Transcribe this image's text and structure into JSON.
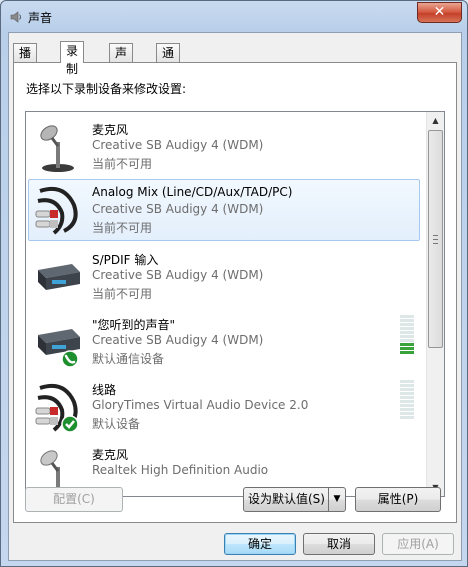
{
  "window": {
    "title": "声音",
    "close_glyph": "✕"
  },
  "tabs": [
    {
      "label": "播放"
    },
    {
      "label": "录制"
    },
    {
      "label": "声音"
    },
    {
      "label": "通信"
    }
  ],
  "active_tab": "录制",
  "instruction": "选择以下录制设备来修改设置:",
  "devices": [
    {
      "name": "麦克风",
      "driver": "Creative SB Audigy 4 (WDM)",
      "status": "当前不可用",
      "icon": "microphone-icon"
    },
    {
      "name": "Analog Mix (Line/CD/Aux/TAD/PC)",
      "driver": "Creative SB Audigy 4 (WDM)",
      "status": "当前不可用",
      "icon": "audio-cable-icon",
      "selected": true
    },
    {
      "name": "S/PDIF 输入",
      "driver": "Creative SB Audigy 4 (WDM)",
      "status": "当前不可用",
      "icon": "sound-card-icon"
    },
    {
      "name": "\"您听到的声音\"",
      "driver": "Creative SB Audigy 4 (WDM)",
      "status": "默认通信设备",
      "icon": "sound-card-icon",
      "badge": "phone-badge-icon",
      "level": 0.3
    },
    {
      "name": "线路",
      "driver": "GloryTimes Virtual Audio Device 2.0",
      "status": "默认设备",
      "icon": "audio-cable-icon",
      "badge": "check-badge-icon",
      "level": 0
    },
    {
      "name": "麦克风",
      "driver": "Realtek High Definition Audio",
      "status": "",
      "icon": "microphone-icon"
    }
  ],
  "buttons": {
    "configure": "配置(C)",
    "set_default": "设为默认值(S)",
    "properties": "属性(P)",
    "ok": "确定",
    "cancel": "取消",
    "apply": "应用(A)"
  },
  "scrollbar": {
    "up_glyph": "▲",
    "down_glyph": "▼"
  },
  "colors": {
    "selection_border": "#a8c9ef",
    "meter_on": "#3aa23a",
    "close_red": "#c43f28"
  }
}
